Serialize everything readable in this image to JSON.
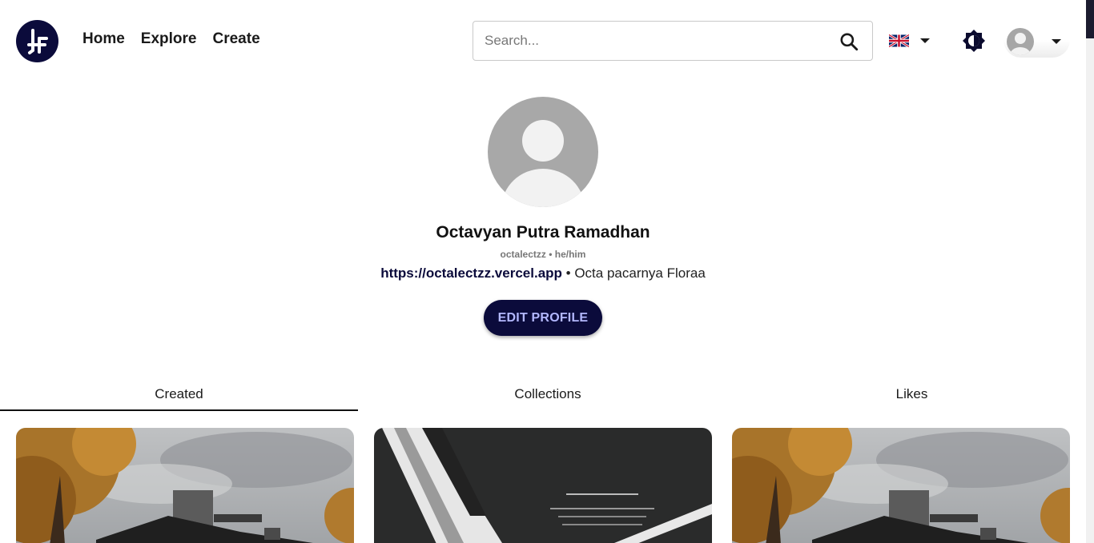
{
  "nav": {
    "home": "Home",
    "explore": "Explore",
    "create": "Create"
  },
  "search": {
    "placeholder": "Search..."
  },
  "profile": {
    "name": "Octavyan Putra Ramadhan",
    "handle": "octalectzz • he/him",
    "website": "https://octalectzz.vercel.app",
    "bio_separator": " • ",
    "bio": "Octa pacarnya Floraa",
    "edit_button": "EDIT PROFILE"
  },
  "tabs": [
    {
      "label": "Created",
      "active": true
    },
    {
      "label": "Collections",
      "active": false
    },
    {
      "label": "Likes",
      "active": false
    }
  ],
  "cards": [
    {
      "image": "house-autumn-photo"
    },
    {
      "image": "the-weekend-house-magazine-photo"
    },
    {
      "image": "house-autumn-photo"
    }
  ],
  "colors": {
    "brand": "#0b0b3b",
    "button_text": "#b3b8ff"
  },
  "icons": {
    "logo": "lf-logo",
    "search": "search-icon",
    "language": "uk-flag-icon",
    "theme": "brightness-icon",
    "user": "user-avatar-icon"
  }
}
